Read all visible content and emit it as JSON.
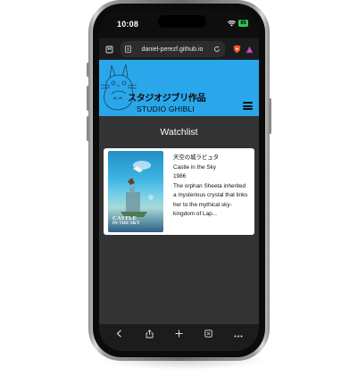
{
  "status_bar": {
    "time": "10:08",
    "battery": "85"
  },
  "browser": {
    "url": "daniel-perezf.github.io"
  },
  "site": {
    "brand_jp": "スタジオジブリ作品",
    "brand_en": "STUDIO GHIBLI"
  },
  "watchlist": {
    "title": "Watchlist",
    "items": [
      {
        "poster_title_line1": "CASTLE",
        "poster_title_line2": "IN THE SKY",
        "original_title": "天空の城ラピュタ",
        "title": "Castle in the Sky",
        "year": "1986",
        "description": "The orphan Sheeta inherited a mysterious crystal that links her to the mythical sky-kingdom of Lap..."
      }
    ]
  },
  "colors": {
    "header_bg": "#2aa7ea",
    "page_bg": "#333333",
    "card_bg": "#ffffff"
  },
  "icons": {
    "toolbar_left": "bookmark-icon",
    "url_left": "page-settings-icon",
    "url_right": "reload-icon",
    "brave": "brave-shield-icon",
    "rewards": "rewards-icon",
    "back": "back-icon",
    "share": "share-icon",
    "new_tab": "plus-icon",
    "tabs": "tabs-icon",
    "more": "more-icon"
  }
}
